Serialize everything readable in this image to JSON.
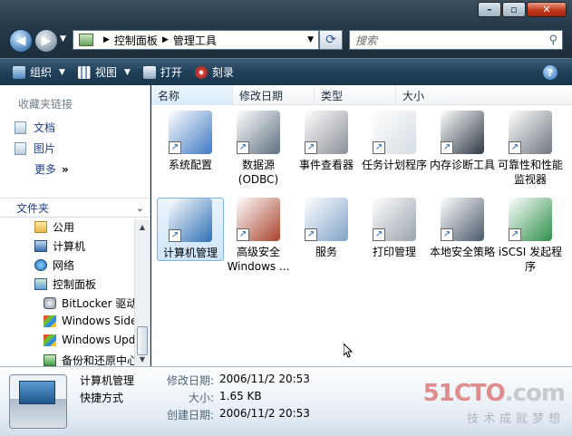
{
  "address": {
    "crumbs": [
      "控制面板",
      "管理工具"
    ]
  },
  "search": {
    "placeholder": "搜索"
  },
  "toolbar": {
    "organize": "组织",
    "views": "视图",
    "open": "打开",
    "burn": "刻录"
  },
  "nav": {
    "favorites_header": "收藏夹链接",
    "favorites": [
      "文档",
      "图片"
    ],
    "more": "更多",
    "folders_header": "文件夹",
    "tree": [
      "公用",
      "计算机",
      "网络",
      "控制面板",
      "BitLocker 驱动",
      "Windows Side",
      "Windows Upd",
      "备份和还原中心"
    ]
  },
  "columns": [
    "名称",
    "修改日期",
    "类型",
    "大小"
  ],
  "items": [
    {
      "label": "系统配置",
      "icon": "system-config-icon",
      "color": "#3f79c4"
    },
    {
      "label": "数据源 (ODBC)",
      "icon": "odbc-icon",
      "color": "#5d6f80"
    },
    {
      "label": "事件查看器",
      "icon": "event-viewer-icon",
      "color": "#8b8f96"
    },
    {
      "label": "任务计划程序",
      "icon": "task-scheduler-icon",
      "color": "#d7dde3"
    },
    {
      "label": "内存诊断工具",
      "icon": "memory-diagnostic-icon",
      "color": "#2f3a45"
    },
    {
      "label": "可靠性和性能监视器",
      "icon": "reliability-monitor-icon",
      "color": "#6f7780"
    },
    {
      "label": "计算机管理",
      "icon": "computer-management-icon",
      "color": "#2f6fb5"
    },
    {
      "label": "高级安全 Windows ...",
      "icon": "firewall-icon",
      "color": "#a8442c"
    },
    {
      "label": "服务",
      "icon": "services-icon",
      "color": "#7fa3c9"
    },
    {
      "label": "打印管理",
      "icon": "print-management-icon",
      "color": "#9aa3ab"
    },
    {
      "label": "本地安全策略",
      "icon": "local-security-policy-icon",
      "color": "#4a5a6a"
    },
    {
      "label": "iSCSI 发起程序",
      "icon": "iscsi-icon",
      "color": "#2e8f4a"
    }
  ],
  "details": {
    "name": "计算机管理",
    "type": "快捷方式",
    "modified_label": "修改日期:",
    "modified": "2006/11/2 20:53",
    "size_label": "大小:",
    "size": "1.65 KB",
    "created_label": "创建日期:",
    "created": "2006/11/2 20:53"
  },
  "watermark": {
    "logo_main": "51CTO",
    "logo_suffix": ".com",
    "tagline": "技术成就梦想"
  }
}
